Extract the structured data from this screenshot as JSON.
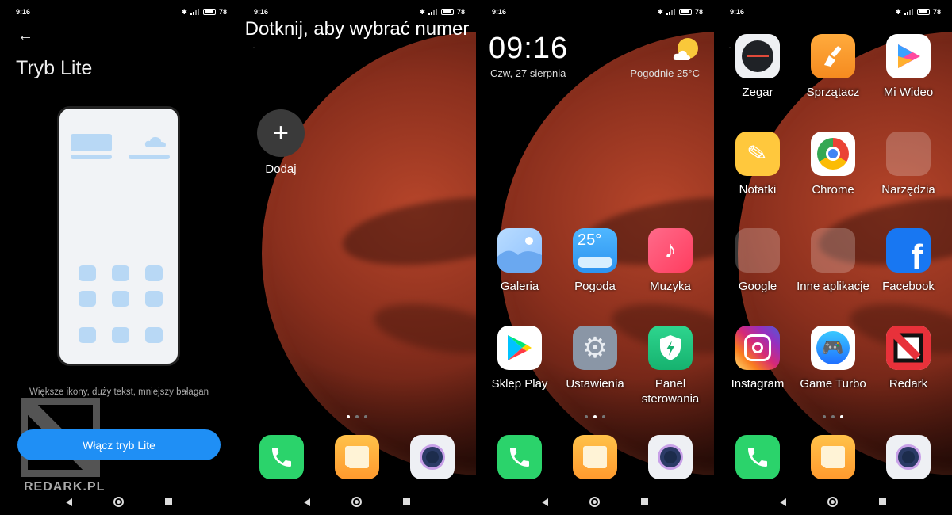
{
  "status": {
    "time": "9:16",
    "battery": "78"
  },
  "panel1": {
    "title": "Tryb Lite",
    "description": "Większe ikony, duży tekst, mniejszy bałagan",
    "button": "Włącz tryb Lite",
    "watermark": "REDARK.PL"
  },
  "panel2": {
    "title": "Dotknij, aby wybrać numer",
    "add_label": "Dodaj"
  },
  "panel3": {
    "clock": "09:16",
    "date": "Czw, 27 sierpnia",
    "weather": "Pogodnie  25°C",
    "apps": {
      "galeria": "Galeria",
      "pogoda": "Pogoda",
      "pogoda_icon_text": "25°",
      "muzyka": "Muzyka",
      "sklep": "Sklep Play",
      "ustawienia": "Ustawienia",
      "panel": "Panel sterowania"
    }
  },
  "panel4": {
    "apps": {
      "zegar": "Zegar",
      "sprzatacz": "Sprzątacz",
      "miwideo": "Mi Wideo",
      "notatki": "Notatki",
      "chrome": "Chrome",
      "narzedzia": "Narzędzia",
      "google": "Google",
      "inne": "Inne aplikacje",
      "facebook": "Facebook",
      "instagram": "Instagram",
      "gameturbo": "Game Turbo",
      "redark": "Redark"
    }
  },
  "icons": [
    "back-arrow-icon",
    "bluetooth-icon",
    "signal-icon",
    "battery-icon",
    "plus-icon",
    "sun-cloud-icon",
    "phone-icon",
    "messages-icon",
    "camera-icon",
    "nav-back-icon",
    "nav-home-icon",
    "nav-recents-icon"
  ],
  "colors": {
    "accent": "#1f8ff5",
    "preview_blue": "#b8d8f5"
  }
}
